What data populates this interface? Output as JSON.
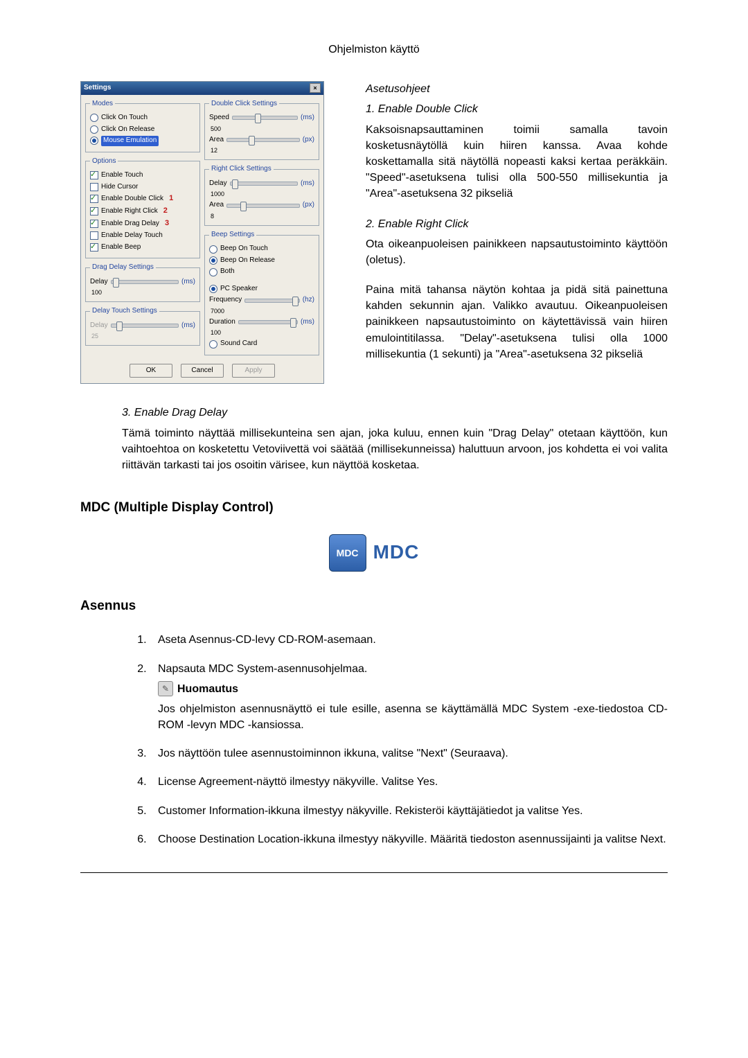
{
  "page_header": "Ohjelmiston käyttö",
  "instructions": {
    "heading": "Asetusohjeet",
    "item1_title": "1. Enable Double Click",
    "item1_body": "Kaksoisnapsauttaminen toimii samalla tavoin kosketusnäytöllä kuin hiiren kanssa. Avaa kohde koskettamalla sitä näytöllä nopeasti kaksi kertaa peräkkäin. \"Speed\"-asetuksena tulisi olla 500-550 millisekuntia ja \"Area\"-asetuksena 32 pikseliä",
    "item2_title": "2. Enable Right Click",
    "item2_body_a": "Ota oikeanpuoleisen painikkeen napsautustoiminto käyttöön (oletus).",
    "item2_body_b": "Paina mitä tahansa näytön kohtaa ja pidä sitä painettuna kahden sekunnin ajan. Valikko avautuu. Oikeanpuoleisen painikkeen napsautustoiminto on käytettävissä vain hiiren emulointitilassa. \"Delay\"-asetuksena tulisi olla 1000 millisekuntia (1 sekunti) ja \"Area\"-asetuksena 32 pikseliä",
    "item3_title": "3. Enable Drag Delay",
    "item3_body": "Tämä toiminto näyttää millisekunteina sen ajan, joka kuluu, ennen kuin \"Drag Delay\" otetaan käyttöön, kun vaihtoehtoa on kosketettu Vetoviivettä voi säätää (millisekunneissa) haluttuun arvoon, jos kohdetta ei voi valita riittävän tarkasti tai jos osoitin värisee, kun näyttöä kosketaa."
  },
  "mdc_heading": "MDC (Multiple Display Control)",
  "mdc_logo_text": "MDC",
  "install_heading": "Asennus",
  "install": {
    "step1": "Aseta Asennus-CD-levy CD-ROM-asemaan.",
    "step2": "Napsauta MDC System-asennusohjelmaa.",
    "note_label": "Huomautus",
    "note_body": "Jos ohjelmiston asennusnäyttö ei tule esille, asenna se käyttämällä MDC System -exe-tiedostoa CD-ROM -levyn MDC -kansiossa.",
    "step3": "Jos näyttöön tulee asennustoiminnon ikkuna, valitse \"Next\" (Seuraava).",
    "step4": "License Agreement-näyttö ilmestyy näkyville. Valitse Yes.",
    "step5": "Customer Information-ikkuna ilmestyy näkyville. Rekisteröi käyttäjätiedot ja valitse Yes.",
    "step6": "Choose Destination Location-ikkuna ilmestyy näkyville. Määritä tiedoston asennussijainti ja valitse Next."
  },
  "dialog": {
    "title": "Settings",
    "modes": {
      "legend": "Modes",
      "click_on_touch": "Click On Touch",
      "click_on_release": "Click On Release",
      "mouse_emulation": "Mouse Emulation"
    },
    "options": {
      "legend": "Options",
      "enable_touch": "Enable Touch",
      "hide_cursor": "Hide Cursor",
      "enable_double_click": "Enable Double Click",
      "enable_right_click": "Enable Right Click",
      "enable_drag_delay": "Enable Drag Delay",
      "enable_delay_touch": "Enable Delay Touch",
      "enable_beep": "Enable Beep",
      "m1": "1",
      "m2": "2",
      "m3": "3"
    },
    "drag_delay": {
      "legend": "Drag Delay Settings",
      "label": "Delay",
      "value": "100",
      "unit": "(ms)"
    },
    "delay_touch": {
      "legend": "Delay Touch Settings",
      "label": "Delay",
      "value": "25",
      "unit": "(ms)"
    },
    "double_click": {
      "legend": "Double Click Settings",
      "speed_label": "Speed",
      "speed_value": "500",
      "speed_unit": "(ms)",
      "area_label": "Area",
      "area_value": "12",
      "area_unit": "(px)"
    },
    "right_click": {
      "legend": "Right Click Settings",
      "delay_label": "Delay",
      "delay_value": "1000",
      "delay_unit": "(ms)",
      "area_label": "Area",
      "area_value": "8",
      "area_unit": "(px)"
    },
    "beep": {
      "legend": "Beep Settings",
      "beep_on_touch": "Beep On Touch",
      "beep_on_release": "Beep On Release",
      "both": "Both",
      "pc_speaker": "PC Speaker",
      "freq_label": "Frequency",
      "freq_value": "7000",
      "freq_unit": "(hz)",
      "dur_label": "Duration",
      "dur_value": "100",
      "dur_unit": "(ms)",
      "sound_card": "Sound Card"
    },
    "buttons": {
      "ok": "OK",
      "cancel": "Cancel",
      "apply": "Apply"
    }
  }
}
